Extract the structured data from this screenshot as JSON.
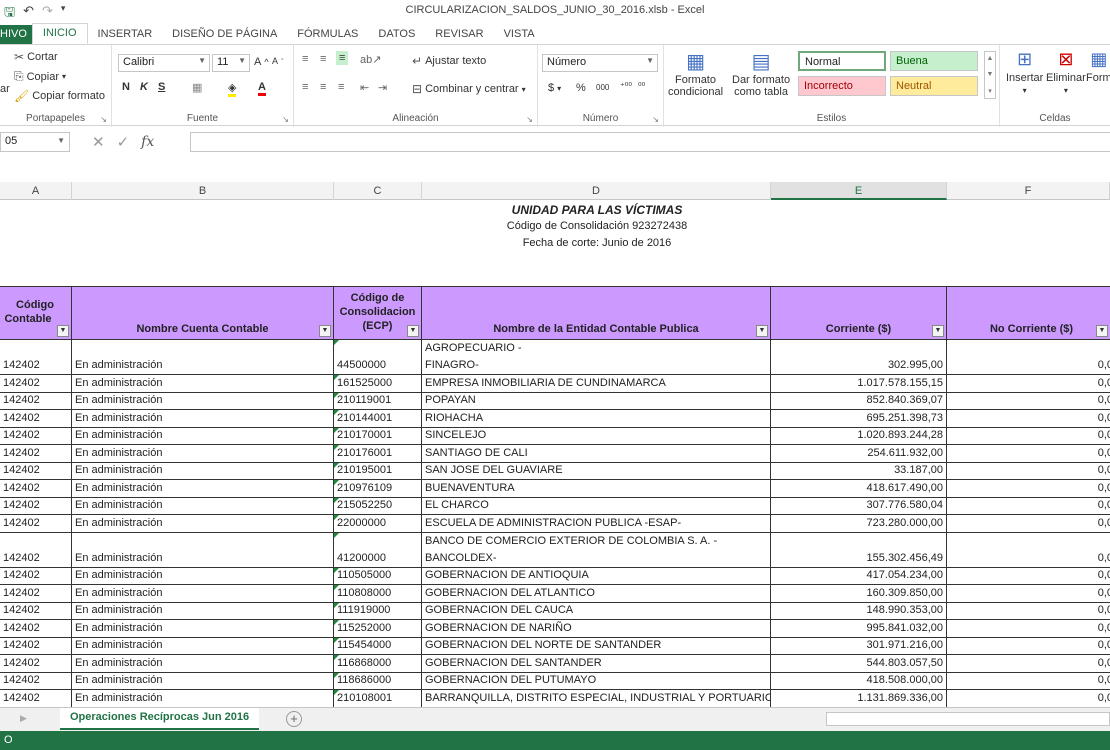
{
  "window": {
    "title": "CIRCULARIZACION_SALDOS_JUNIO_30_2016.xlsb - Excel"
  },
  "tabs": [
    "HIVO",
    "INICIO",
    "INSERTAR",
    "DISEÑO DE PÁGINA",
    "FÓRMULAS",
    "DATOS",
    "REVISAR",
    "VISTA"
  ],
  "ribbon": {
    "clipboard": {
      "cut": "Cortar",
      "copy": "Copiar",
      "paste": "ar",
      "format_painter": "Copiar formato",
      "label": "Portapapeles"
    },
    "font": {
      "name": "Calibri",
      "size": "11",
      "bold": "N",
      "italic": "K",
      "underline": "S",
      "label": "Fuente"
    },
    "alignment": {
      "wrap": "Ajustar texto",
      "merge": "Combinar y centrar",
      "label": "Alineación"
    },
    "number": {
      "format": "Número",
      "currency": "$",
      "percent": "%",
      "thousands": "000",
      "dec_inc": "⁺⁰⁰",
      "dec_dec": "⁰⁰",
      "label": "Número"
    },
    "styles": {
      "cond_format_1": "Formato",
      "cond_format_2": "condicional",
      "as_table_1": "Dar formato",
      "as_table_2": "como tabla",
      "normal": "Normal",
      "buena": "Buena",
      "incorrecto": "Incorrecto",
      "neutral": "Neutral",
      "label": "Estilos"
    },
    "cells": {
      "insert": "Insertar",
      "delete": "Eliminar",
      "format": "Form",
      "label": "Celdas"
    }
  },
  "formula_bar": {
    "name_box": "05",
    "fx": "fx",
    "value": ""
  },
  "columns": [
    "A",
    "B",
    "C",
    "D",
    "E",
    "F"
  ],
  "sheet_titles": {
    "title": "UNIDAD PARA LAS VÍCTIMAS",
    "subtitle": "Código de Consolidación 923272438",
    "date": "Fecha de corte: Junio de 2016"
  },
  "headers": {
    "a1": "Código",
    "a2": "Contable",
    "b": "Nombre Cuenta Contable",
    "c1": "Código de",
    "c2": "Consolidacion",
    "c3": "(ECP)",
    "d": "Nombre de la Entidad Contable Publica",
    "e": "Corriente ($)",
    "f": "No Corriente ($)"
  },
  "rows": [
    {
      "a": "142402",
      "b": "En administración",
      "c": "44500000",
      "d1": "FONDO PARA EL FINANCIAMIENTO DEL SECTOR AGROPECUARIO -",
      "d2": "FINAGRO-",
      "e": "302.995,00",
      "f": "0,0"
    },
    {
      "a": "142402",
      "b": "En administración",
      "c": "161525000",
      "d": "EMPRESA INMOBILIARIA DE CUNDINAMARCA",
      "e": "1.017.578.155,15",
      "f": "0,0"
    },
    {
      "a": "142402",
      "b": "En administración",
      "c": "210119001",
      "d": "POPAYAN",
      "e": "852.840.369,07",
      "f": "0,0"
    },
    {
      "a": "142402",
      "b": "En administración",
      "c": "210144001",
      "d": "RIOHACHA",
      "e": "695.251.398,73",
      "f": "0,0"
    },
    {
      "a": "142402",
      "b": "En administración",
      "c": "210170001",
      "d": "SINCELEJO",
      "e": "1.020.893.244,28",
      "f": "0,0"
    },
    {
      "a": "142402",
      "b": "En administración",
      "c": "210176001",
      "d": "SANTIAGO DE CALI",
      "e": "254.611.932,00",
      "f": "0,0"
    },
    {
      "a": "142402",
      "b": "En administración",
      "c": "210195001",
      "d": "SAN JOSE DEL GUAVIARE",
      "e": "33.187,00",
      "f": "0,0"
    },
    {
      "a": "142402",
      "b": "En administración",
      "c": "210976109",
      "d": "BUENAVENTURA",
      "e": "418.617.490,00",
      "f": "0,0"
    },
    {
      "a": "142402",
      "b": "En administración",
      "c": "215052250",
      "d": "EL CHARCO",
      "e": "307.776.580,04",
      "f": "0,0"
    },
    {
      "a": "142402",
      "b": "En administración",
      "c": "22000000",
      "d": "ESCUELA DE ADMINISTRACION PUBLICA -ESAP-",
      "e": "723.280.000,00",
      "f": "0,0"
    },
    {
      "a": "142402",
      "b": "En administración",
      "c": "41200000",
      "d1": "BANCO DE COMERCIO EXTERIOR DE COLOMBIA S. A. -",
      "d2": "BANCOLDEX-",
      "e": "155.302.456,49",
      "f": "0,0"
    },
    {
      "a": "142402",
      "b": "En administración",
      "c": "110505000",
      "d": "GOBERNACION DE ANTIOQUIA",
      "e": "417.054.234,00",
      "f": "0,0"
    },
    {
      "a": "142402",
      "b": "En administración",
      "c": "110808000",
      "d": "GOBERNACION DEL ATLANTICO",
      "e": "160.309.850,00",
      "f": "0,0"
    },
    {
      "a": "142402",
      "b": "En administración",
      "c": "111919000",
      "d": "GOBERNACION DEL CAUCA",
      "e": "148.990.353,00",
      "f": "0,0"
    },
    {
      "a": "142402",
      "b": "En administración",
      "c": "115252000",
      "d": "GOBERNACION DE NARIÑO",
      "e": "995.841.032,00",
      "f": "0,0"
    },
    {
      "a": "142402",
      "b": "En administración",
      "c": "115454000",
      "d": "GOBERNACION DEL NORTE DE SANTANDER",
      "e": "301.971.216,00",
      "f": "0,0"
    },
    {
      "a": "142402",
      "b": "En administración",
      "c": "116868000",
      "d": "GOBERNACION DEL SANTANDER",
      "e": "544.803.057,50",
      "f": "0,0"
    },
    {
      "a": "142402",
      "b": "En administración",
      "c": "118686000",
      "d": "GOBERNACION DEL PUTUMAYO",
      "e": "418.508.000,00",
      "f": "0,0"
    },
    {
      "a": "142402",
      "b": "En administración",
      "c": "210108001",
      "d": "BARRANQUILLA, DISTRITO ESPECIAL, INDUSTRIAL Y PORTUARIO",
      "e": "1.131.869.336,00",
      "f": "0,0"
    }
  ],
  "sheet_tab": "Operaciones Recíprocas Jun 2016",
  "status": "O",
  "colors": {
    "accent": "#217346",
    "header_fill": "#cc99ff"
  }
}
